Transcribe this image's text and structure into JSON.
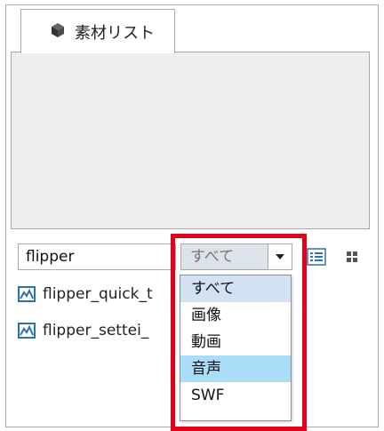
{
  "panel": {
    "tab_label": "素材リスト",
    "tab_icon": "cube-icon"
  },
  "toolbar": {
    "search_value": "flipper",
    "filter_selected": "すべて",
    "view_list_icon": "list-view-icon",
    "view_grid_icon": "grid-view-icon"
  },
  "files": [
    {
      "name": "flipper_quick_t",
      "icon": "image-icon"
    },
    {
      "name": "flipper_settei_",
      "icon": "image-icon"
    }
  ],
  "dropdown": {
    "options": [
      "すべて",
      "画像",
      "動画",
      "音声",
      "SWF"
    ],
    "selected_index": 0,
    "hover_index": 3
  },
  "colors": {
    "highlight": "#e3001b",
    "selected_bg": "#d3e2f3",
    "hover_bg": "#aaddf8",
    "icon_blue": "#2d6fb6"
  }
}
